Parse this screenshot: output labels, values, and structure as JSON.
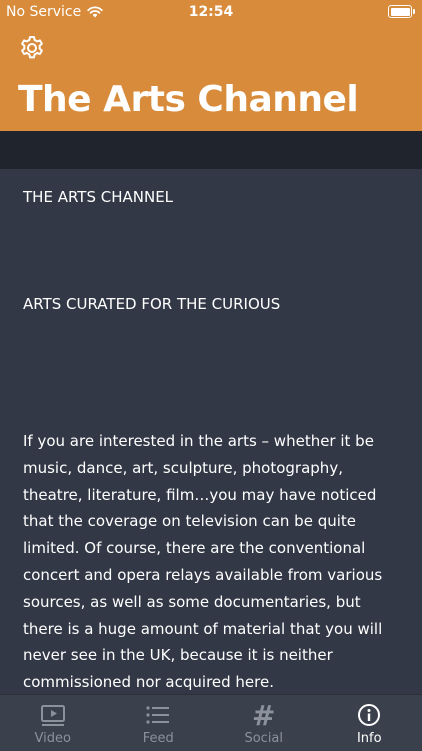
{
  "status_bar": {
    "carrier": "No Service",
    "time": "12:54"
  },
  "header": {
    "title": "The Arts Channel"
  },
  "content": {
    "paragraphs": [
      "THE ARTS CHANNEL",
      "ARTS CURATED FOR THE CURIOUS",
      "If you are interested in the arts – whether it be music, dance, art, sculpture, photography, theatre, literature, film…you may have noticed that the coverage on television can be quite limited. Of course, there are the conventional concert and opera relays available from various sources, as well as some documentaries, but there is a huge amount of material that you will never see in the UK, because it is neither commissioned nor acquired here."
    ]
  },
  "tabs": [
    {
      "label": "Video",
      "icon": "video-icon",
      "active": false
    },
    {
      "label": "Feed",
      "icon": "list-icon",
      "active": false
    },
    {
      "label": "Social",
      "icon": "hashtag-icon",
      "active": false
    },
    {
      "label": "Info",
      "icon": "info-icon",
      "active": true
    }
  ],
  "colors": {
    "header": "#d88b3a",
    "background": "#323846",
    "band": "#20242c",
    "tabbar": "#3a404c"
  }
}
